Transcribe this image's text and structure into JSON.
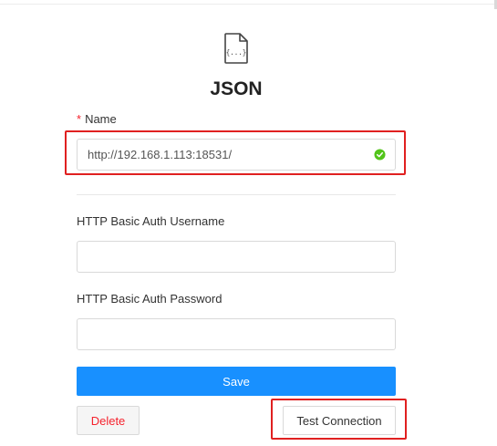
{
  "header": {
    "icon": "json-file-icon",
    "icon_text": "{...}",
    "title": "JSON"
  },
  "form": {
    "name": {
      "label": "Name",
      "required_mark": "*",
      "value": "http://192.168.1.113:18531/",
      "status": "valid"
    },
    "username": {
      "label": "HTTP Basic Auth Username",
      "value": "",
      "placeholder": ""
    },
    "password": {
      "label": "HTTP Basic Auth Password",
      "value": "",
      "placeholder": ""
    }
  },
  "actions": {
    "save_label": "Save",
    "delete_label": "Delete",
    "test_label": "Test Connection"
  },
  "colors": {
    "primary": "#1890ff",
    "danger": "#f5222d",
    "success": "#52c41a",
    "highlight": "#e02020"
  }
}
